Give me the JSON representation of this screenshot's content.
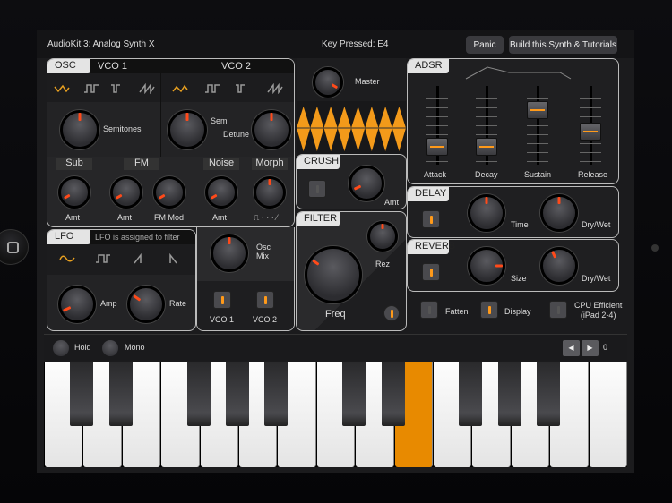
{
  "app_title": "AudioKit 3: Analog Synth X",
  "key_pressed": "Key Pressed: E4",
  "buttons": {
    "panic": "Panic",
    "build": "Build this Synth & Tutorials"
  },
  "osc": {
    "tab": "OSC",
    "vco1": "VCO 1",
    "vco2": "VCO 2",
    "waveforms": [
      "triangle",
      "square",
      "pulse",
      "sawtooth"
    ],
    "selected_waveform_vco1": "triangle",
    "selected_waveform_vco2": "triangle",
    "semitones_label": "Semitones",
    "semi_label": "Semi",
    "detune_label": "Detune",
    "sub": "Sub",
    "fm": "FM",
    "noise": "Noise",
    "morph": "Morph",
    "amt": "Amt",
    "fm_mod": "FM Mod",
    "morph_range": "⎍ · · · ⁄"
  },
  "lfo": {
    "tab": "LFO",
    "status": "LFO is assigned to filter",
    "amp": "Amp",
    "rate": "Rate",
    "selected_waveform": "sine"
  },
  "mix": {
    "osc_mix": "Osc",
    "osc_mix2": "Mix",
    "vco1": "VCO 1",
    "vco2": "VCO 2",
    "vco1_on": true,
    "vco2_on": true
  },
  "master": {
    "label": "Master"
  },
  "crush": {
    "tab": "CRUSH",
    "amt": "Amt",
    "enabled": false
  },
  "filter": {
    "tab": "FILTER",
    "freq": "Freq",
    "rez": "Rez"
  },
  "adsr": {
    "tab": "ADSR",
    "attack": "Attack",
    "decay": "Decay",
    "sustain": "Sustain",
    "release": "Release",
    "values": {
      "attack": 0.15,
      "decay": 0.15,
      "sustain": 0.75,
      "release": 0.4
    }
  },
  "delay": {
    "tab": "DELAY",
    "time": "Time",
    "drywet": "Dry/Wet",
    "enabled": true
  },
  "reverb": {
    "tab": "REVERB",
    "size": "Size",
    "drywet": "Dry/Wet",
    "enabled": true
  },
  "options": {
    "fatten": "Fatten",
    "display": "Display",
    "cpu1": "CPU Efficient",
    "cpu2": "(iPad 2-4)",
    "fatten_on": false,
    "display_on": true,
    "cpu_on": false
  },
  "keyboard": {
    "hold": "Hold",
    "mono": "Mono",
    "octave": "0",
    "pressed_key": "E4"
  }
}
